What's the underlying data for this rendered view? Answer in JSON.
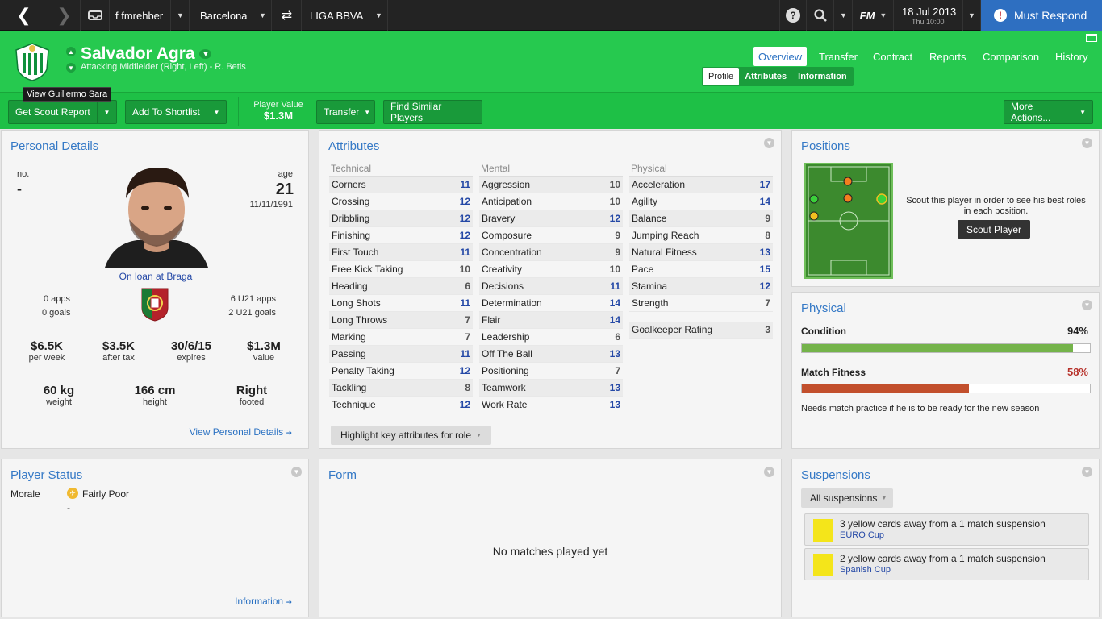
{
  "topbar": {
    "user": "f fmrehber",
    "club": "Barcelona",
    "league": "LIGA BBVA",
    "fm_label": "FM",
    "date": "18 Jul 2013",
    "time": "Thu 10:00",
    "must_respond": "Must Respond"
  },
  "player": {
    "name": "Salvador Agra",
    "subtitle": "Attacking Midfielder (Right, Left) - R. Betis"
  },
  "nav": {
    "tabs": [
      "Overview",
      "Transfer",
      "Contract",
      "Reports",
      "Comparison",
      "History"
    ],
    "subtabs": [
      "Profile",
      "Attributes",
      "Information"
    ]
  },
  "toolbar": {
    "scout_report": "Get Scout Report",
    "shortlist": "Add To Shortlist",
    "player_value_label": "Player Value",
    "player_value": "$1.3M",
    "transfer": "Transfer",
    "similar": "Find Similar Players",
    "more_actions": "More Actions...",
    "tooltip": "View Guillermo Sara"
  },
  "personal": {
    "title": "Personal Details",
    "no_label": "no.",
    "no_value": "-",
    "age_label": "age",
    "age_value": "21",
    "dob": "11/11/1991",
    "loan": "On loan at Braga",
    "apps": "0 apps",
    "goals": "0 goals",
    "u21_apps": "6 U21 apps",
    "u21_goals": "2 U21 goals",
    "stats": [
      {
        "value": "$6.5K",
        "label": "per week"
      },
      {
        "value": "$3.5K",
        "label": "after tax"
      },
      {
        "value": "30/6/15",
        "label": "expires"
      },
      {
        "value": "$1.3M",
        "label": "value"
      }
    ],
    "body": [
      {
        "value": "60 kg",
        "label": "weight"
      },
      {
        "value": "166 cm",
        "label": "height"
      },
      {
        "value": "Right",
        "label": "footed"
      }
    ],
    "link": "View Personal Details"
  },
  "attributes": {
    "title": "Attributes",
    "technical_header": "Technical",
    "mental_header": "Mental",
    "physical_header": "Physical",
    "technical": [
      {
        "name": "Corners",
        "value": "11"
      },
      {
        "name": "Crossing",
        "value": "12"
      },
      {
        "name": "Dribbling",
        "value": "12"
      },
      {
        "name": "Finishing",
        "value": "12"
      },
      {
        "name": "First Touch",
        "value": "11"
      },
      {
        "name": "Free Kick Taking",
        "value": "10"
      },
      {
        "name": "Heading",
        "value": "6"
      },
      {
        "name": "Long Shots",
        "value": "11"
      },
      {
        "name": "Long Throws",
        "value": "7"
      },
      {
        "name": "Marking",
        "value": "7"
      },
      {
        "name": "Passing",
        "value": "11"
      },
      {
        "name": "Penalty Taking",
        "value": "12"
      },
      {
        "name": "Tackling",
        "value": "8"
      },
      {
        "name": "Technique",
        "value": "12"
      }
    ],
    "mental": [
      {
        "name": "Aggression",
        "value": "10"
      },
      {
        "name": "Anticipation",
        "value": "10"
      },
      {
        "name": "Bravery",
        "value": "12"
      },
      {
        "name": "Composure",
        "value": "9"
      },
      {
        "name": "Concentration",
        "value": "9"
      },
      {
        "name": "Creativity",
        "value": "10"
      },
      {
        "name": "Decisions",
        "value": "11"
      },
      {
        "name": "Determination",
        "value": "14"
      },
      {
        "name": "Flair",
        "value": "14"
      },
      {
        "name": "Leadership",
        "value": "6"
      },
      {
        "name": "Off The Ball",
        "value": "13"
      },
      {
        "name": "Positioning",
        "value": "7"
      },
      {
        "name": "Teamwork",
        "value": "13"
      },
      {
        "name": "Work Rate",
        "value": "13"
      }
    ],
    "physical": [
      {
        "name": "Acceleration",
        "value": "17"
      },
      {
        "name": "Agility",
        "value": "14"
      },
      {
        "name": "Balance",
        "value": "9"
      },
      {
        "name": "Jumping Reach",
        "value": "8"
      },
      {
        "name": "Natural Fitness",
        "value": "13"
      },
      {
        "name": "Pace",
        "value": "15"
      },
      {
        "name": "Stamina",
        "value": "12"
      },
      {
        "name": "Strength",
        "value": "7"
      }
    ],
    "gk_label": "Goalkeeper Rating",
    "gk_value": "3",
    "highlight": "Highlight key attributes for role"
  },
  "positions": {
    "title": "Positions",
    "text": "Scout this player in order to see his best roles in each position.",
    "button": "Scout Player"
  },
  "physical": {
    "title": "Physical",
    "condition_label": "Condition",
    "condition_value": "94%",
    "condition_pct": 94,
    "fitness_label": "Match Fitness",
    "fitness_value": "58%",
    "fitness_pct": 58,
    "note": "Needs match practice if he is to be ready for the new season",
    "colors": {
      "condition": "#74b34a",
      "fitness": "#c24f2c"
    }
  },
  "status": {
    "title": "Player Status",
    "morale_label": "Morale",
    "morale_value": "Fairly Poor",
    "dash": "-",
    "link": "Information"
  },
  "form": {
    "title": "Form",
    "empty": "No matches played yet"
  },
  "suspensions": {
    "title": "Suspensions",
    "filter": "All suspensions",
    "items": [
      {
        "text": "3 yellow cards away from a 1 match suspension",
        "comp": "EURO Cup"
      },
      {
        "text": "2 yellow cards away from a 1 match suspension",
        "comp": "Spanish Cup"
      }
    ]
  }
}
